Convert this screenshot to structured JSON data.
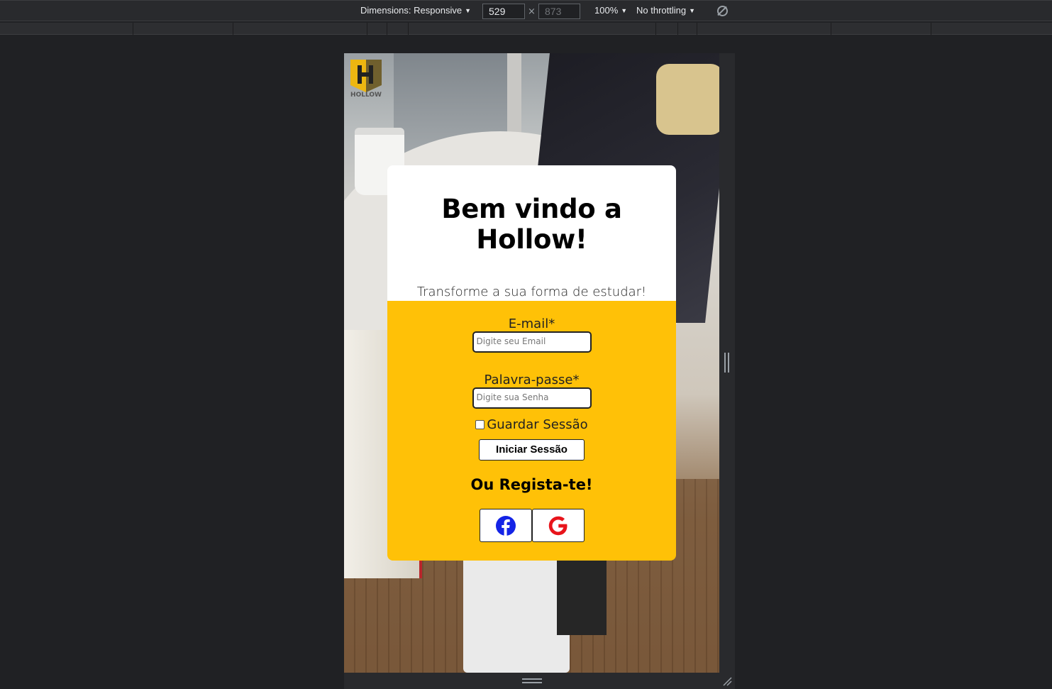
{
  "devtools": {
    "dimensions_label": "Dimensions: Responsive",
    "width_value": "529",
    "height_value": "873",
    "times": "×",
    "zoom": "100%",
    "throttling": "No throttling"
  },
  "logo": {
    "text": "HOLLOW",
    "letter": "H",
    "color": "#f5b800"
  },
  "card": {
    "title": "Bem vindo a Hollow!",
    "subtitle": "Transforme a sua forma de estudar!",
    "email_label": "E-mail*",
    "email_placeholder": "Digite seu Email",
    "password_label": "Palavra-passe*",
    "password_placeholder": "Digite sua Senha",
    "remember_label": "Guardar Sessão",
    "login_button": "Iniciar Sessão",
    "register_heading": "Ou Regista-te!",
    "social": [
      {
        "name": "facebook-icon",
        "color": "#1424e6"
      },
      {
        "name": "google-icon",
        "color": "#e8141b"
      }
    ]
  },
  "colors": {
    "accent": "#ffc107",
    "card_top": "#ffffff",
    "devtools_bg": "#202124"
  }
}
